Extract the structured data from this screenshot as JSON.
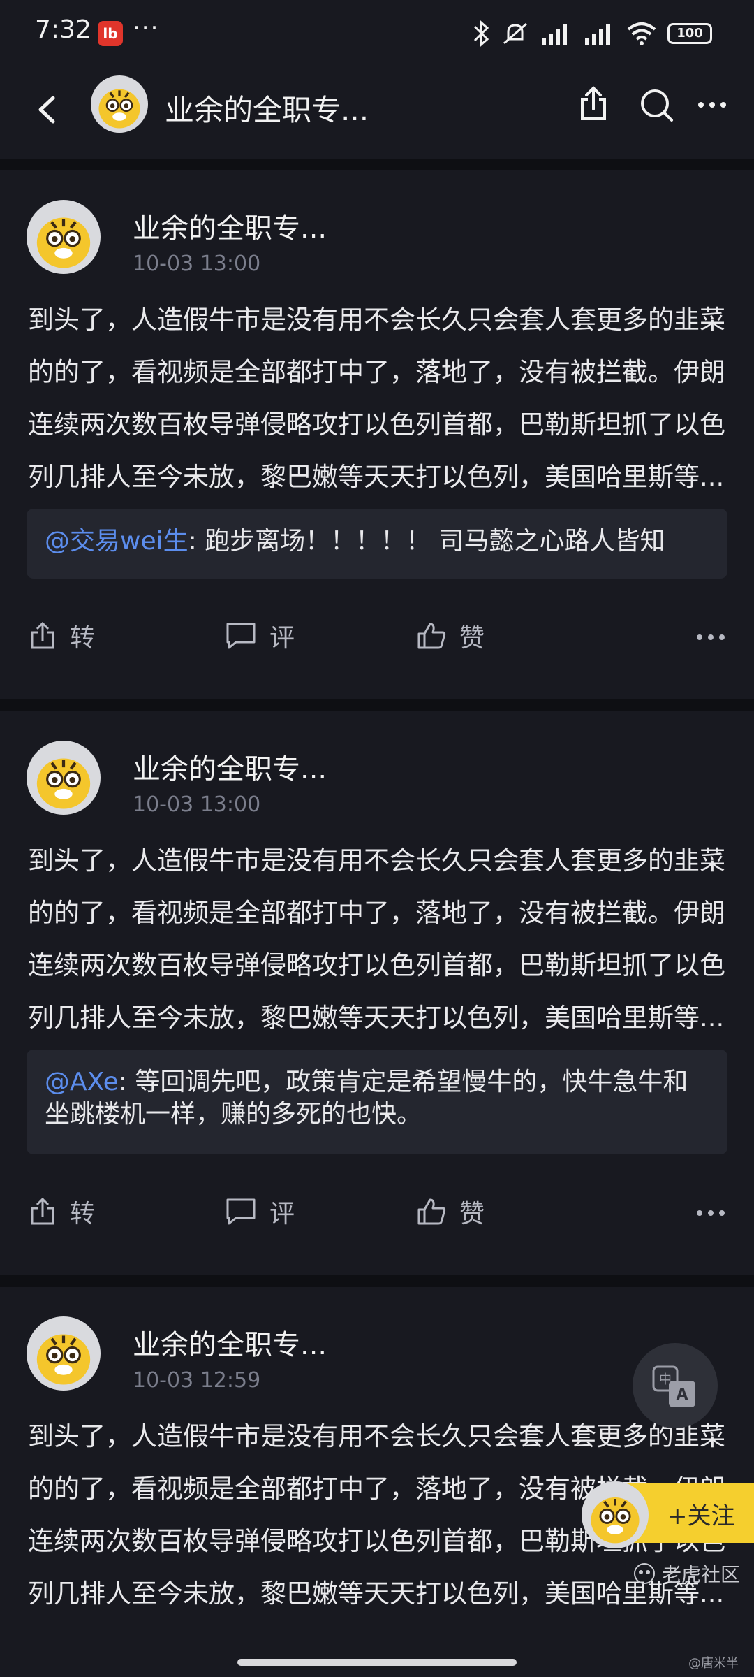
{
  "status_bar": {
    "time": "7:32",
    "app_badge": "lb",
    "dots": "···",
    "battery": "100"
  },
  "header": {
    "title": "业余的全职专..."
  },
  "posts": [
    {
      "author": "业余的全职专...",
      "time": "10-03 13:00",
      "body": "到头了，人造假牛市是没有用不会长久只会套人套更多的韭菜的的了，看视频是全部都打中了，落地了，没有被拦截。伊朗连续两次数百枚导弹侵略攻打以色列首都，巴勒斯坦抓了以色列几排人至今未放，黎巴嫩等天天打以色列，美国哈里斯等...",
      "quote_mention": "@交易wei生",
      "quote_text": ": 跑步离场！！！！！ 司马懿之心路人皆知",
      "actions": {
        "repost": "转",
        "comment": "评",
        "like": "赞"
      }
    },
    {
      "author": "业余的全职专...",
      "time": "10-03 13:00",
      "body": "到头了，人造假牛市是没有用不会长久只会套人套更多的韭菜的的了，看视频是全部都打中了，落地了，没有被拦截。伊朗连续两次数百枚导弹侵略攻打以色列首都，巴勒斯坦抓了以色列几排人至今未放，黎巴嫩等天天打以色列，美国哈里斯等...",
      "quote_mention": "@AXe",
      "quote_text": ": 等回调先吧，政策肯定是希望慢牛的，快牛急牛和坐跳楼机一样，赚的多死的也快。",
      "actions": {
        "repost": "转",
        "comment": "评",
        "like": "赞"
      }
    },
    {
      "author": "业余的全职专...",
      "time": "10-03 12:59",
      "body": "到头了，人造假牛市是没有用不会长久只会套人套更多的韭菜的的了，看视频是全部都打中了，落地了，没有被拦截。伊朗连续两次数百枚导弹侵略攻打以色列首都，巴勒斯坦抓了以色列几排人至今未放，黎巴嫩等天天打以色列，美国哈里斯等..."
    }
  ],
  "follow": {
    "label": "+关注"
  },
  "watermark": {
    "brand": "老虎社区",
    "user": "@唐米半"
  },
  "colors": {
    "background": "#0e0f13",
    "card": "#181920",
    "mention": "#5c8ded",
    "follow": "#f5cf2e"
  },
  "icons": [
    "back-icon",
    "share-icon",
    "search-icon",
    "more-icon",
    "repost-icon",
    "comment-icon",
    "like-icon",
    "translate-icon",
    "tiger-avatar"
  ]
}
